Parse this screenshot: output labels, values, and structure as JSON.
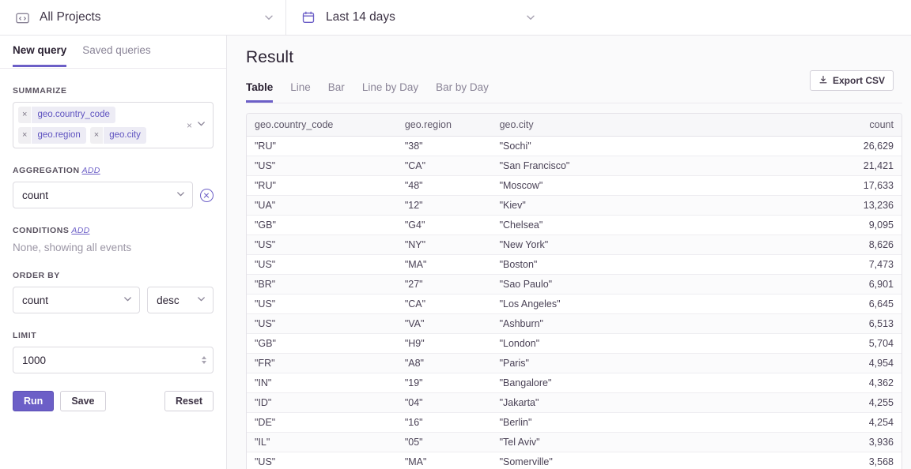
{
  "topbar": {
    "project_selector": {
      "label": "All Projects",
      "icon": "code-folder-icon"
    },
    "date_selector": {
      "label": "Last 14 days",
      "icon": "calendar-icon"
    }
  },
  "sidebar": {
    "tabs": [
      {
        "label": "New query",
        "active": true
      },
      {
        "label": "Saved queries",
        "active": false
      }
    ],
    "summarize": {
      "label": "SUMMARIZE",
      "chips": [
        "geo.country_code",
        "geo.region",
        "geo.city"
      ],
      "remove_glyph": "×"
    },
    "aggregation": {
      "label": "AGGREGATION",
      "add_label": "Add",
      "value": "count"
    },
    "conditions": {
      "label": "CONDITIONS",
      "add_label": "Add",
      "empty_text": "None, showing all events"
    },
    "order_by": {
      "label": "ORDER BY",
      "field": "count",
      "direction": "desc"
    },
    "limit": {
      "label": "LIMIT",
      "value": "1000"
    },
    "buttons": {
      "run": "Run",
      "save": "Save",
      "reset": "Reset"
    }
  },
  "result": {
    "title": "Result",
    "tabs": [
      {
        "label": "Table",
        "active": true
      },
      {
        "label": "Line",
        "active": false
      },
      {
        "label": "Bar",
        "active": false
      },
      {
        "label": "Line by Day",
        "active": false
      },
      {
        "label": "Bar by Day",
        "active": false
      }
    ],
    "export_label": "Export CSV",
    "table": {
      "columns": [
        "geo.country_code",
        "geo.region",
        "geo.city",
        "count"
      ],
      "rows": [
        [
          "\"RU\"",
          "\"38\"",
          "\"Sochi\"",
          "26,629"
        ],
        [
          "\"US\"",
          "\"CA\"",
          "\"San Francisco\"",
          "21,421"
        ],
        [
          "\"RU\"",
          "\"48\"",
          "\"Moscow\"",
          "17,633"
        ],
        [
          "\"UA\"",
          "\"12\"",
          "\"Kiev\"",
          "13,236"
        ],
        [
          "\"GB\"",
          "\"G4\"",
          "\"Chelsea\"",
          "9,095"
        ],
        [
          "\"US\"",
          "\"NY\"",
          "\"New York\"",
          "8,626"
        ],
        [
          "\"US\"",
          "\"MA\"",
          "\"Boston\"",
          "7,473"
        ],
        [
          "\"BR\"",
          "\"27\"",
          "\"Sao Paulo\"",
          "6,901"
        ],
        [
          "\"US\"",
          "\"CA\"",
          "\"Los Angeles\"",
          "6,645"
        ],
        [
          "\"US\"",
          "\"VA\"",
          "\"Ashburn\"",
          "6,513"
        ],
        [
          "\"GB\"",
          "\"H9\"",
          "\"London\"",
          "5,704"
        ],
        [
          "\"FR\"",
          "\"A8\"",
          "\"Paris\"",
          "4,954"
        ],
        [
          "\"IN\"",
          "\"19\"",
          "\"Bangalore\"",
          "4,362"
        ],
        [
          "\"ID\"",
          "\"04\"",
          "\"Jakarta\"",
          "4,255"
        ],
        [
          "\"DE\"",
          "\"16\"",
          "\"Berlin\"",
          "4,254"
        ],
        [
          "\"IL\"",
          "\"05\"",
          "\"Tel Aviv\"",
          "3,936"
        ],
        [
          "\"US\"",
          "\"MA\"",
          "\"Somerville\"",
          "3,568"
        ]
      ]
    }
  },
  "colors": {
    "accent": "#6c5fc7",
    "chip_text": "#5f53c0",
    "panel_bg": "#fafafb"
  }
}
